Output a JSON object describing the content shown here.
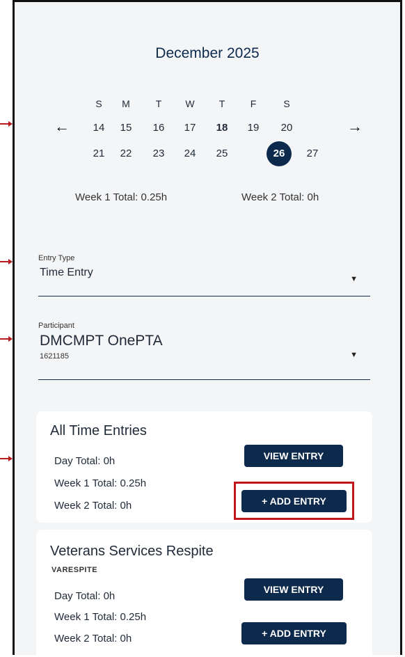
{
  "calendar": {
    "month_label": "December 2025",
    "weekdays": [
      "S",
      "M",
      "T",
      "W",
      "T",
      "F",
      "S"
    ],
    "week_rows": [
      [
        "14",
        "15",
        "16",
        "17",
        "18",
        "19",
        "20"
      ],
      [
        "21",
        "22",
        "23",
        "24",
        "25",
        "26",
        "27"
      ]
    ],
    "today": "18",
    "selected": "26",
    "prev_icon": "←",
    "next_icon": "→"
  },
  "totals": {
    "week1": "Week 1 Total: 0.25h",
    "week2": "Week 2 Total: 0h"
  },
  "entry_type": {
    "label": "Entry Type",
    "value": "Time Entry",
    "caret": "▼"
  },
  "participant": {
    "label": "Participant",
    "name": "DMCMPT OnePTA",
    "id": "1621185",
    "caret": "▼"
  },
  "cards": [
    {
      "title": "All Time Entries",
      "code": "",
      "day_total": "Day Total: 0h",
      "week1_total": "Week 1 Total: 0.25h",
      "week2_total": "Week 2 Total: 0h",
      "view_label": "VIEW ENTRY",
      "add_label": "+ ADD ENTRY"
    },
    {
      "title": "Veterans Services Respite",
      "code": "VARESPITE",
      "day_total": "Day Total: 0h",
      "week1_total": "Week 1 Total: 0.25h",
      "week2_total": "Week 2 Total: 0h",
      "view_label": "VIEW ENTRY",
      "add_label": "+ ADD ENTRY"
    }
  ],
  "colors": {
    "primary": "#0d2a4d",
    "highlight": "#c0161c",
    "background": "#f4f5f7"
  }
}
